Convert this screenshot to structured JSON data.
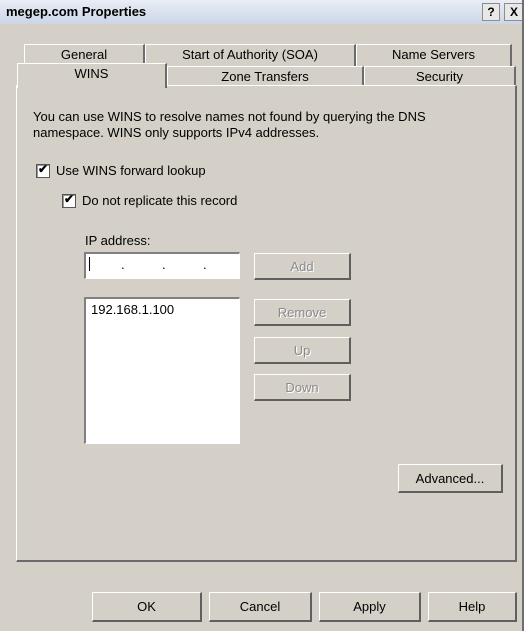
{
  "window": {
    "title": "megep.com Properties",
    "help_label": "?",
    "close_label": "X"
  },
  "tabs": {
    "row1": [
      "General",
      "Start of Authority (SOA)",
      "Name Servers"
    ],
    "row2": [
      "WINS",
      "Zone Transfers",
      "Security"
    ],
    "selected": "WINS"
  },
  "wins": {
    "description": "You can use WINS to resolve names not found by querying the DNS namespace.  WINS only supports IPv4 addresses.",
    "use_forward_lookup_label": "Use WINS forward lookup",
    "use_forward_lookup_checked": true,
    "do_not_replicate_label": "Do not replicate this record",
    "do_not_replicate_checked": true,
    "ip_address_label": "IP address:",
    "ip_input_dots": [
      ".",
      ".",
      "."
    ],
    "add_label": "Add",
    "ip_list": [
      "192.168.1.100"
    ],
    "remove_label": "Remove",
    "up_label": "Up",
    "down_label": "Down",
    "advanced_label": "Advanced..."
  },
  "footer": {
    "ok_label": "OK",
    "cancel_label": "Cancel",
    "apply_label": "Apply",
    "help_label": "Help"
  }
}
